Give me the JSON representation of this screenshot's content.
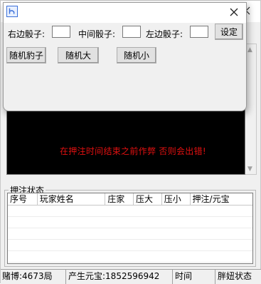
{
  "main_window": {
    "warning_text": "在押注时间结束之前作弊 否则会出错!",
    "bet_group": {
      "title": "押注状态",
      "columns": [
        "序号",
        "玩家姓名",
        "庄家",
        "压大",
        "压小",
        "押注/元宝"
      ],
      "rows": []
    },
    "statusbar": {
      "gamble_count": "赌博:4673局",
      "generated_yuanbao": "产生元宝:1852596942",
      "time_label": "时间",
      "state_label": "胖妞状态"
    }
  },
  "dialog": {
    "right_dice_label": "右边骰子:",
    "right_dice_value": "",
    "middle_dice_label": "中间骰子:",
    "middle_dice_value": "",
    "left_dice_label": "左边骰子:",
    "left_dice_value": "",
    "set_button": "设定",
    "random_dice_button": "随机豹子",
    "random_big_button": "随机大",
    "random_small_button": "随机小"
  },
  "colors": {
    "warning": "#e01010",
    "panel": "#000000",
    "window": "#f0f0f0"
  },
  "icons": [
    "app-icon",
    "close-icon",
    "scroll-up-icon",
    "scroll-down-icon"
  ]
}
